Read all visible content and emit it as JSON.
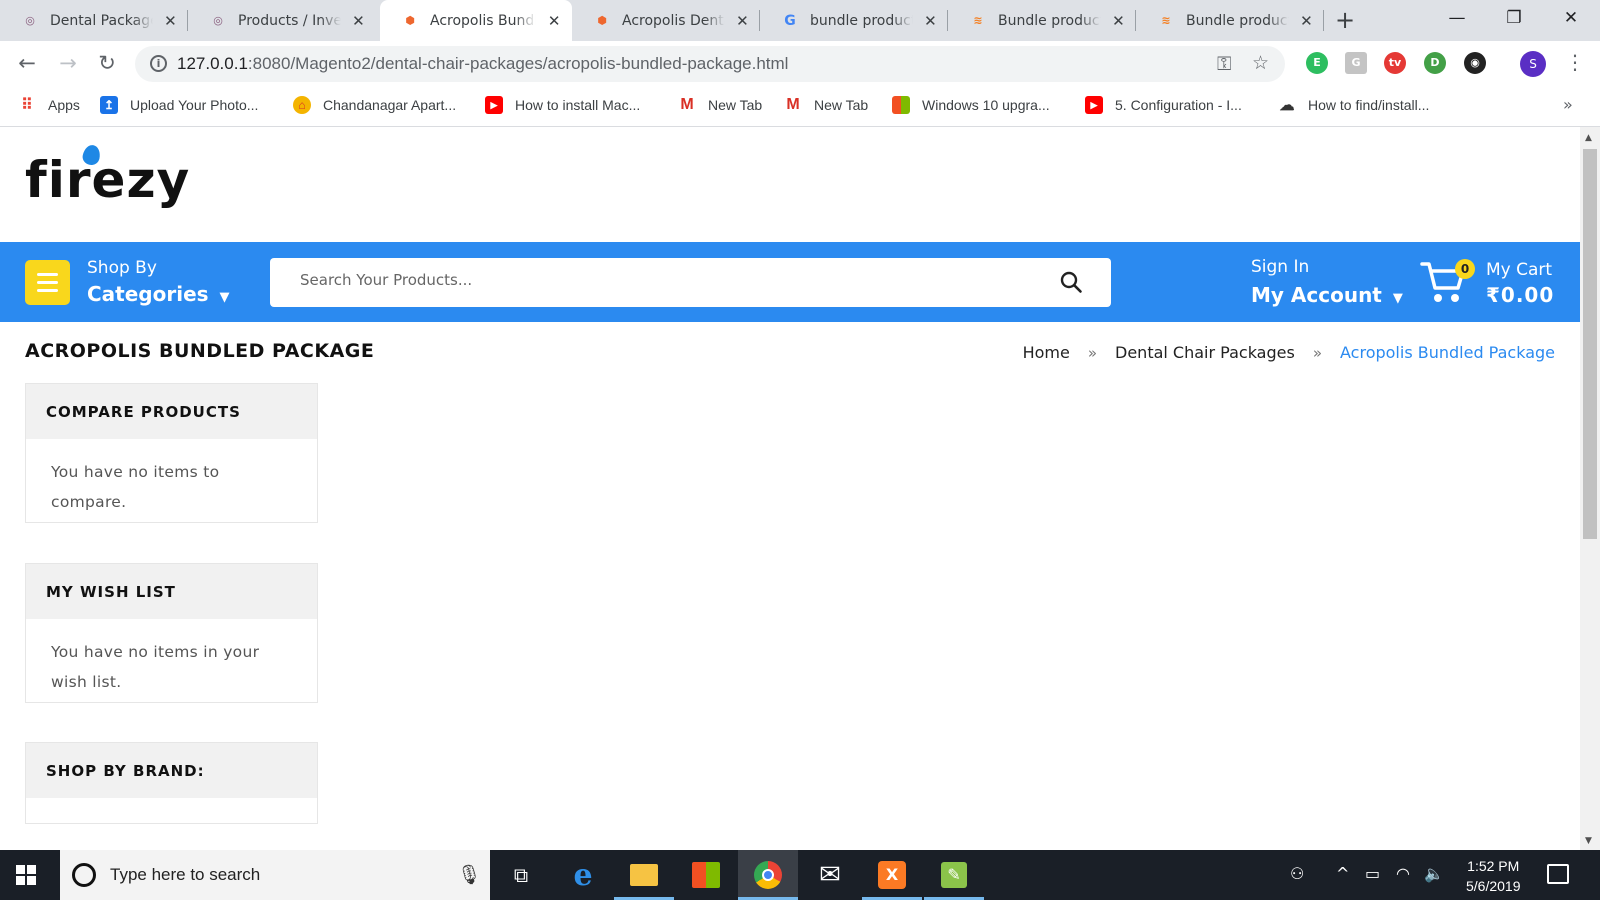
{
  "browser": {
    "tabs": [
      {
        "title": "Dental Packages",
        "icon": "odoo-favicon",
        "active": false
      },
      {
        "title": "Products / Inventory",
        "icon": "odoo-favicon",
        "active": false
      },
      {
        "title": "Acropolis Bundled Package",
        "icon": "magento-favicon",
        "active": true
      },
      {
        "title": "Acropolis Dental",
        "icon": "magento-favicon",
        "active": false
      },
      {
        "title": "bundle product",
        "icon": "google-favicon",
        "active": false
      },
      {
        "title": "Bundle products",
        "icon": "stackoverflow-favicon",
        "active": false
      },
      {
        "title": "Bundle products",
        "icon": "stackoverflow-favicon",
        "active": false
      }
    ],
    "url_host": "127.0.0.1",
    "url_path": ":8080/Magento2/dental-chair-packages/acropolis-bundled-package.html",
    "profile_initial": "S",
    "bookmarks": [
      {
        "label": "Apps",
        "icon": "apps-grid-icon"
      },
      {
        "label": "Upload Your Photo...",
        "icon": "upload-icon"
      },
      {
        "label": "Chandanagar Apart...",
        "icon": "home-icon"
      },
      {
        "label": "How to install Mac...",
        "icon": "youtube-icon"
      },
      {
        "label": "New Tab",
        "icon": "gmail-icon"
      },
      {
        "label": "New Tab",
        "icon": "gmail-icon"
      },
      {
        "label": "Windows 10 upgra...",
        "icon": "windows-icon"
      },
      {
        "label": "5. Configuration - I...",
        "icon": "youtube-icon"
      },
      {
        "label": "How to find/install...",
        "icon": "tool-icon"
      }
    ]
  },
  "site": {
    "logo": "firezy",
    "nav": {
      "shop_by": "Shop By",
      "categories": "Categories",
      "search_placeholder": "Search Your Products...",
      "sign_in": "Sign In",
      "my_account": "My Account",
      "cart_count": "0",
      "my_cart": "My Cart",
      "cart_total": "₹0.00"
    },
    "page_title": "ACROPOLIS BUNDLED PACKAGE",
    "breadcrumb": [
      "Home",
      "Dental Chair Packages",
      "Acropolis Bundled Package"
    ],
    "sidebar": {
      "compare": {
        "title": "COMPARE PRODUCTS",
        "body": "You have no items to compare."
      },
      "wishlist": {
        "title": "MY WISH LIST",
        "body": "You have no items in your wish list."
      },
      "brand": {
        "title": "SHOP BY BRAND:"
      }
    }
  },
  "taskbar": {
    "search_placeholder": "Type here to search",
    "time": "1:52 PM",
    "date": "5/6/2019"
  },
  "colors": {
    "brand_blue": "#2b8af0",
    "accent_yellow": "#f9d71c"
  }
}
